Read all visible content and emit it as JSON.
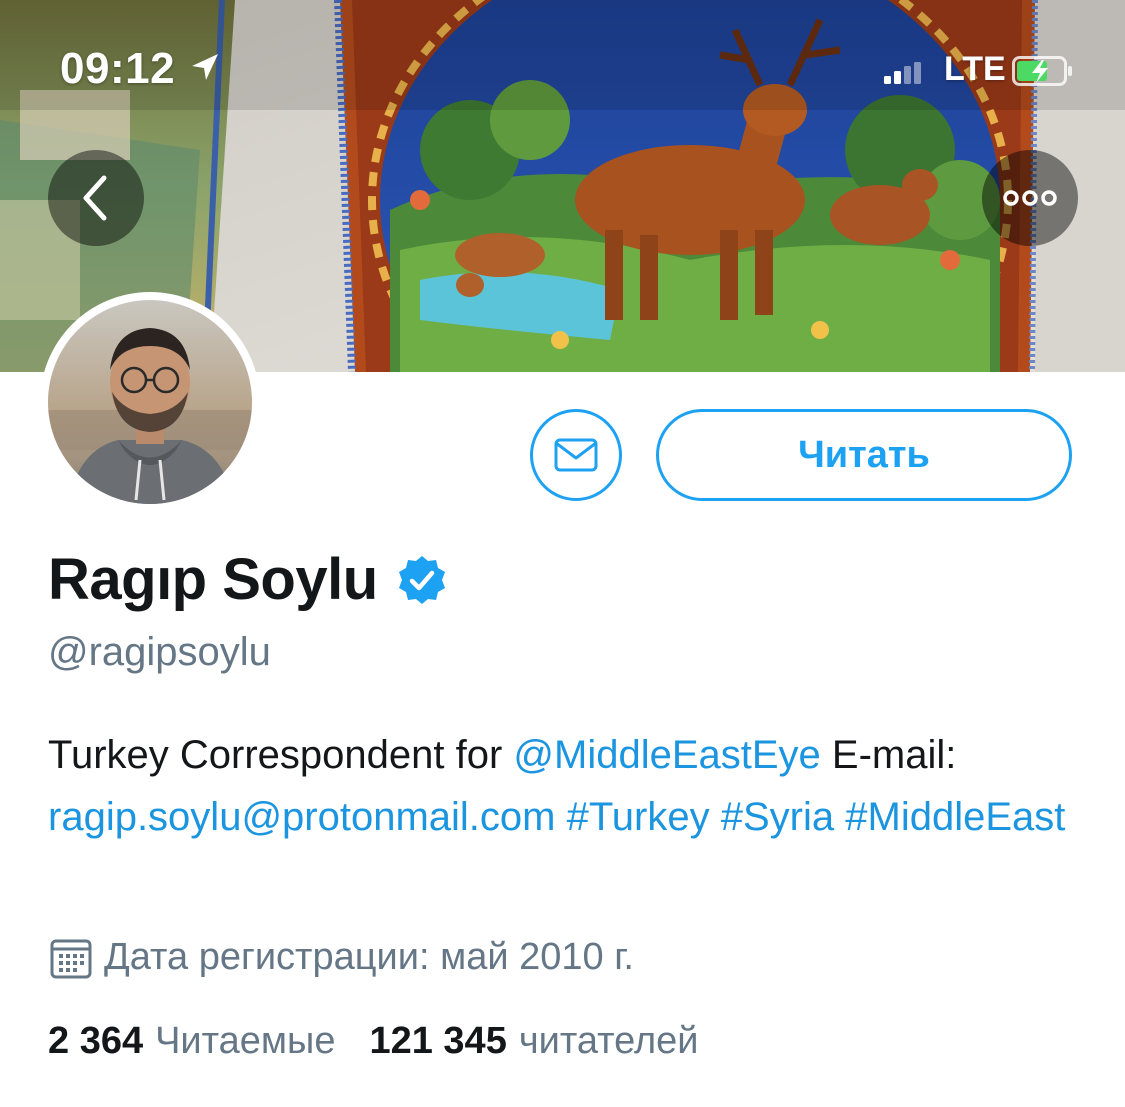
{
  "status_bar": {
    "time": "09:12",
    "network": "LTE",
    "icons": [
      "location-arrow-icon",
      "signal-icon",
      "battery-charging-icon"
    ]
  },
  "navigation": {
    "back_icon": "chevron-left-icon",
    "more_icon": "more-dots-icon"
  },
  "profile": {
    "display_name": "Ragıp Soylu",
    "verified": true,
    "handle": "@ragipsoylu",
    "bio": {
      "part1": "Turkey Correspondent for ",
      "mention": "@MiddleEastEye",
      "part2": " E-mail: ",
      "email": "ragip.soylu@protonmail.com",
      "hashtag1": "#Turkey",
      "hashtag2": "#Syria",
      "hashtag3": "#MiddleEast"
    },
    "joined": "Дата регистрации: май 2010 г.",
    "stats": {
      "following_count": "2 364",
      "following_label": "Читаемые",
      "followers_count": "121 345",
      "followers_label": "читателей"
    }
  },
  "actions": {
    "follow_label": "Читать",
    "message_icon": "envelope-icon"
  },
  "colors": {
    "accent": "#1da1f2",
    "link": "#1b95e0",
    "text": "#14171a",
    "secondary": "#657786"
  }
}
